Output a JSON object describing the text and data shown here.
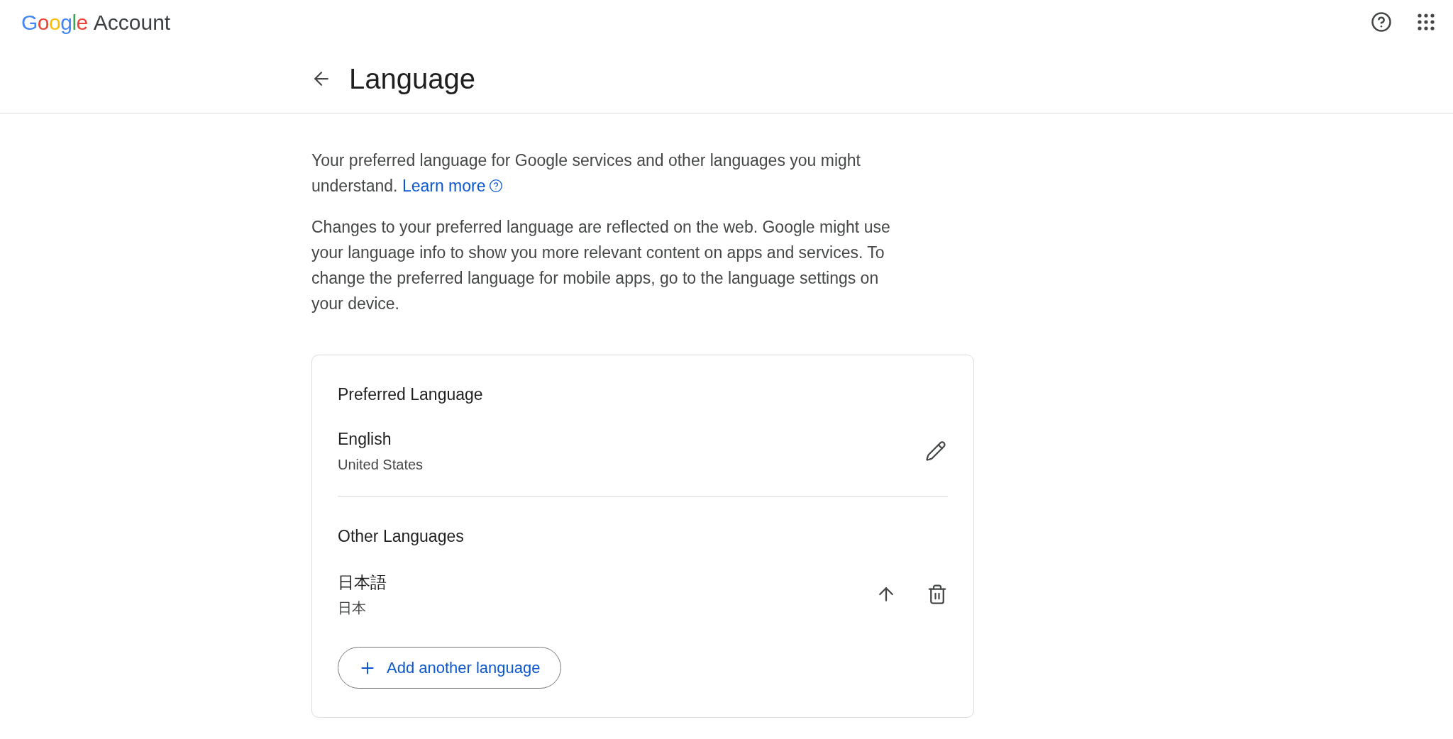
{
  "header": {
    "logo_text": "Google",
    "product": "Account"
  },
  "page": {
    "title": "Language"
  },
  "intro": {
    "text": "Your preferred language for Google services and other languages you might understand.",
    "link": "Learn more"
  },
  "note": "Changes to your preferred language are reflected on the web. Google might use your language info to show you more relevant content on apps and services. To change the preferred language for mobile apps, go to the language settings on your device.",
  "preferred": {
    "heading": "Preferred Language",
    "language": "English",
    "region": "United States"
  },
  "other": {
    "heading": "Other Languages",
    "items": [
      {
        "language": "日本語",
        "region": "日本"
      }
    ],
    "add_button": "Add another language"
  }
}
